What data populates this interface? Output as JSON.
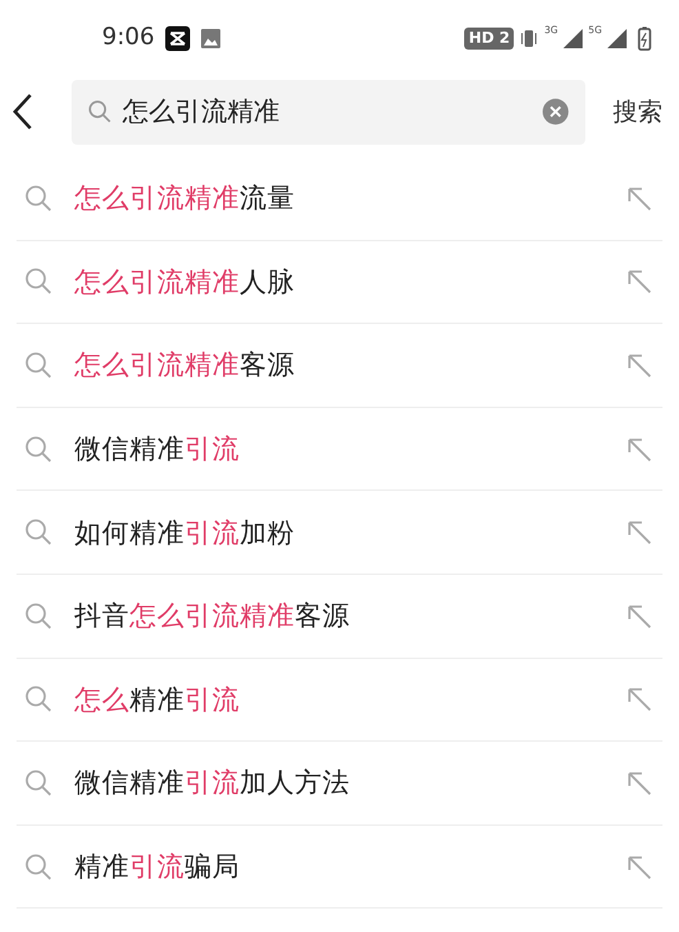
{
  "status_bar": {
    "time": "9:06",
    "hd_badge": "HD 2",
    "networks": [
      "3G",
      "5G"
    ]
  },
  "search": {
    "value": "怎么引流精准",
    "submit": "搜索"
  },
  "suggestions": [
    {
      "segments": [
        {
          "text": "怎么引流精准",
          "highlight": true
        },
        {
          "text": "流量",
          "highlight": false
        }
      ]
    },
    {
      "segments": [
        {
          "text": "怎么引流精准",
          "highlight": true
        },
        {
          "text": "人脉",
          "highlight": false
        }
      ]
    },
    {
      "segments": [
        {
          "text": "怎么引流精准",
          "highlight": true
        },
        {
          "text": "客源",
          "highlight": false
        }
      ]
    },
    {
      "segments": [
        {
          "text": "微信精准",
          "highlight": false
        },
        {
          "text": "引流",
          "highlight": true
        }
      ]
    },
    {
      "segments": [
        {
          "text": "如何精准",
          "highlight": false
        },
        {
          "text": "引流",
          "highlight": true
        },
        {
          "text": "加粉",
          "highlight": false
        }
      ]
    },
    {
      "segments": [
        {
          "text": "抖音",
          "highlight": false
        },
        {
          "text": "怎么引流精准",
          "highlight": true
        },
        {
          "text": "客源",
          "highlight": false
        }
      ]
    },
    {
      "segments": [
        {
          "text": "怎么",
          "highlight": true
        },
        {
          "text": "精准",
          "highlight": false
        },
        {
          "text": "引流",
          "highlight": true
        }
      ]
    },
    {
      "segments": [
        {
          "text": "微信精准",
          "highlight": false
        },
        {
          "text": "引流",
          "highlight": true
        },
        {
          "text": "加人方法",
          "highlight": false
        }
      ]
    },
    {
      "segments": [
        {
          "text": "精准",
          "highlight": false
        },
        {
          "text": "引流",
          "highlight": true
        },
        {
          "text": "骗局",
          "highlight": false
        }
      ]
    }
  ]
}
